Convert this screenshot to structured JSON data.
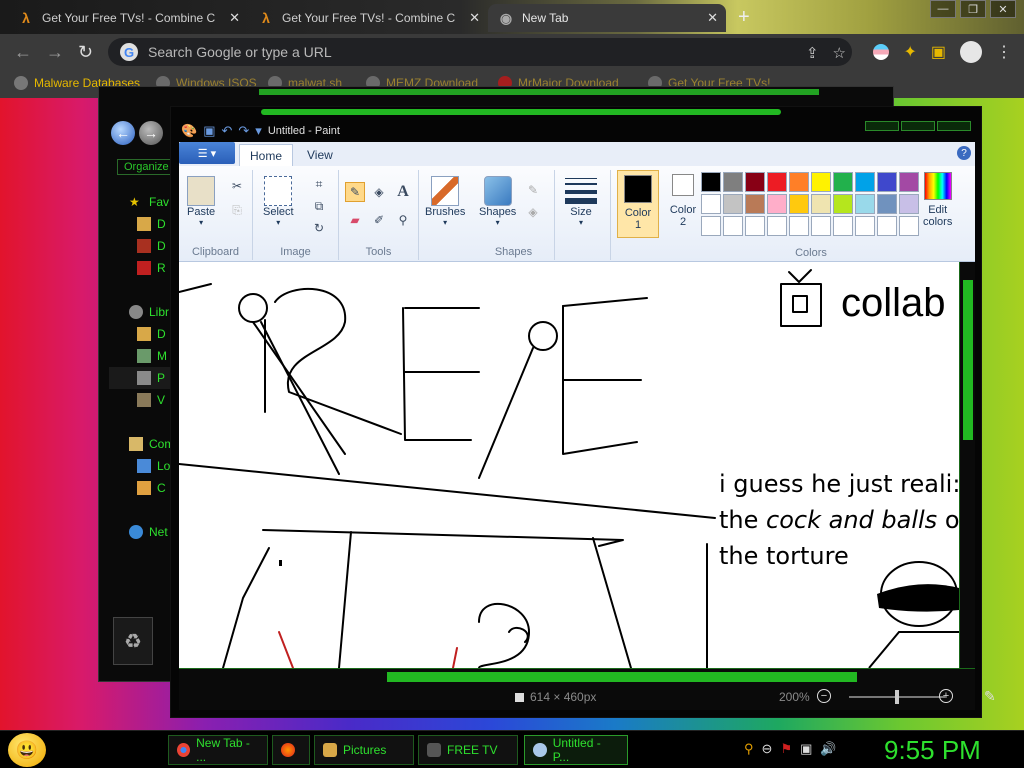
{
  "browser": {
    "tabs": [
      {
        "title": "Get Your Free TVs! - Combine C",
        "icon": "half-life-lambda-icon"
      },
      {
        "title": "Get Your Free TVs! - Combine C",
        "icon": "half-life-lambda-icon"
      },
      {
        "title": "New Tab",
        "icon": "chrome-icon",
        "active": true
      }
    ],
    "omnibox_placeholder": "Search Google or type a URL",
    "bookmarks": [
      "Malware Databases",
      "Windows ISOS",
      "malwat.sh",
      "MEMZ Download",
      "MrMajor Download",
      "Get Your Free TVs!"
    ]
  },
  "explorer": {
    "organize_label": "Organize",
    "tree": [
      {
        "label": "Fav",
        "icon": "star-icon"
      },
      {
        "label": "D",
        "icon": "folder-icon"
      },
      {
        "label": "D",
        "icon": "folder-icon"
      },
      {
        "label": "R",
        "icon": "folder-icon"
      },
      {
        "label": "Libr",
        "icon": "library-icon"
      },
      {
        "label": "D",
        "icon": "folder-icon"
      },
      {
        "label": "M",
        "icon": "music-icon"
      },
      {
        "label": "P",
        "icon": "pictures-icon"
      },
      {
        "label": "V",
        "icon": "video-icon"
      },
      {
        "label": "Com",
        "icon": "computer-icon"
      },
      {
        "label": "Lo",
        "icon": "drive-icon"
      },
      {
        "label": "C",
        "icon": "drive-icon"
      },
      {
        "label": "Net",
        "icon": "network-icon"
      }
    ]
  },
  "paint": {
    "title": "Untitled - Paint",
    "tabs": [
      "Home",
      "View"
    ],
    "groups": {
      "clipboard": {
        "label": "Clipboard",
        "paste": "Paste"
      },
      "image": {
        "label": "Image",
        "select": "Select"
      },
      "tools": {
        "label": "Tools"
      },
      "brushes": {
        "label": "Brushes"
      },
      "shapes": {
        "label": "Shapes",
        "shapes_btn": "Shapes"
      },
      "size": {
        "label": "Size"
      },
      "colors": {
        "label": "Colors",
        "color1": "Color",
        "color1_num": "1",
        "color2": "Color",
        "color2_num": "2",
        "edit": "Edit",
        "edit2": "colors"
      }
    },
    "palette": [
      "#000000",
      "#7f7f7f",
      "#880015",
      "#ed1c24",
      "#ff7f27",
      "#fff200",
      "#22b14c",
      "#00a2e8",
      "#3f48cc",
      "#a349a4",
      "#ffffff",
      "#c3c3c3",
      "#b97a57",
      "#ffaec9",
      "#ffc90e",
      "#efe4b0",
      "#b5e61d",
      "#99d9ea",
      "#7092be",
      "#c8bfe7",
      "#ffffff",
      "#ffffff",
      "#ffffff",
      "#ffffff",
      "#ffffff",
      "#ffffff",
      "#ffffff",
      "#ffffff",
      "#ffffff",
      "#ffffff"
    ],
    "canvas_text": {
      "collab": "collab",
      "line1": "i guess he just reali:",
      "line2a": "the ",
      "line2b": "cock and balls",
      "line2c": " o",
      "line3": "the torture"
    },
    "status": {
      "dimensions": "614 × 460px",
      "zoom": "200%"
    }
  },
  "taskbar": {
    "buttons": [
      {
        "label": "New Tab - ...",
        "icon": "chrome-icon"
      },
      {
        "label": "",
        "icon": "firefox-icon"
      },
      {
        "label": "Pictures",
        "icon": "folder-icon"
      },
      {
        "label": "FREE TV",
        "icon": "video-icon"
      },
      {
        "label": "Untitled - P...",
        "icon": "paint-icon",
        "active": true
      }
    ],
    "clock": "9:55 PM"
  }
}
